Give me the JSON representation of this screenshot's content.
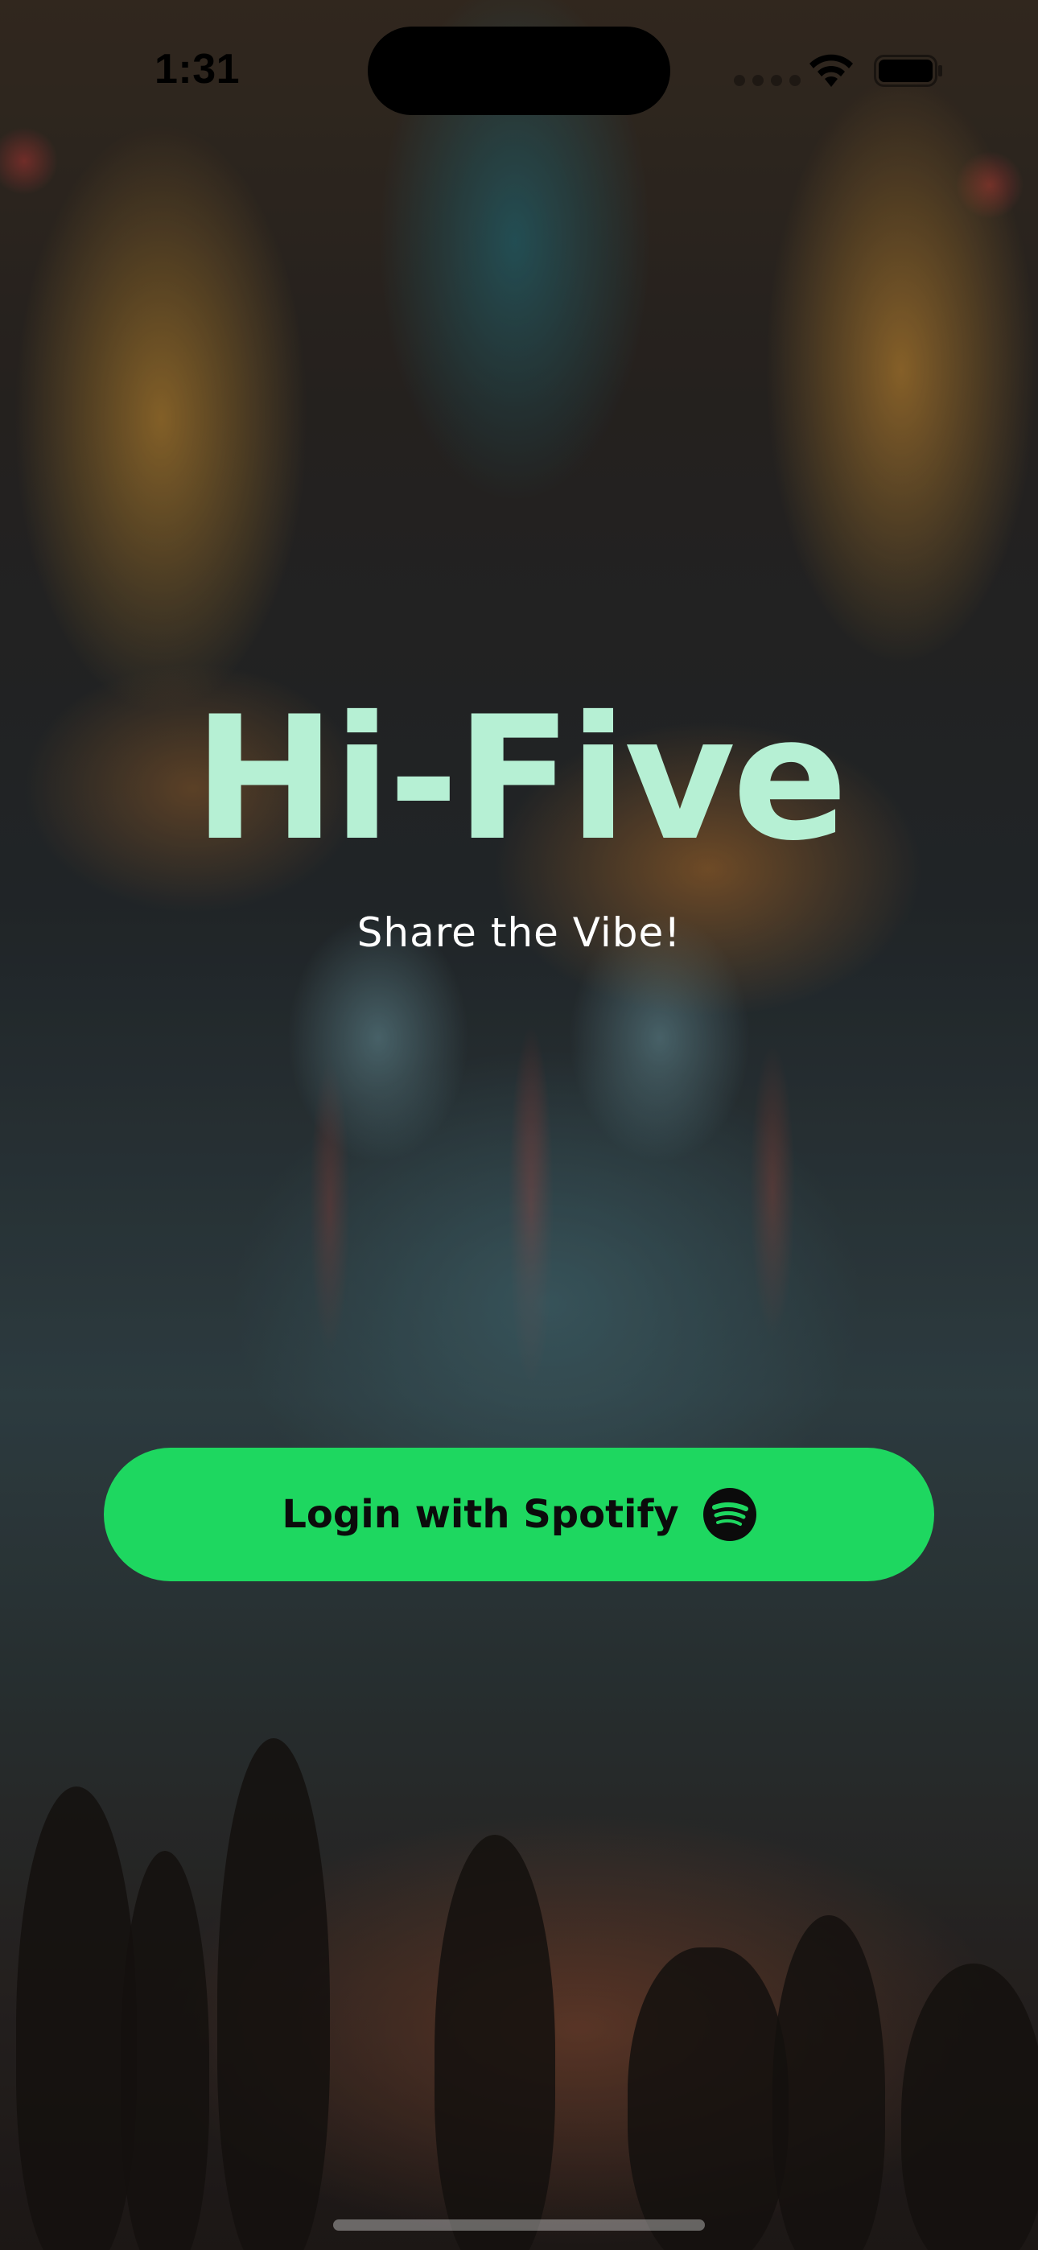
{
  "status_bar": {
    "time": "1:31",
    "icons": [
      "cellular-signal-icon",
      "wifi-icon",
      "battery-icon"
    ]
  },
  "hero": {
    "title": "Hi-Five",
    "tagline": "Share the Vibe!"
  },
  "login": {
    "label": "Login with Spotify",
    "icon": "spotify-icon"
  },
  "colors": {
    "title": "#b6f0d4",
    "button_background": "#1ed760",
    "button_text": "#0b0b0b",
    "tagline": "#ffffff"
  }
}
